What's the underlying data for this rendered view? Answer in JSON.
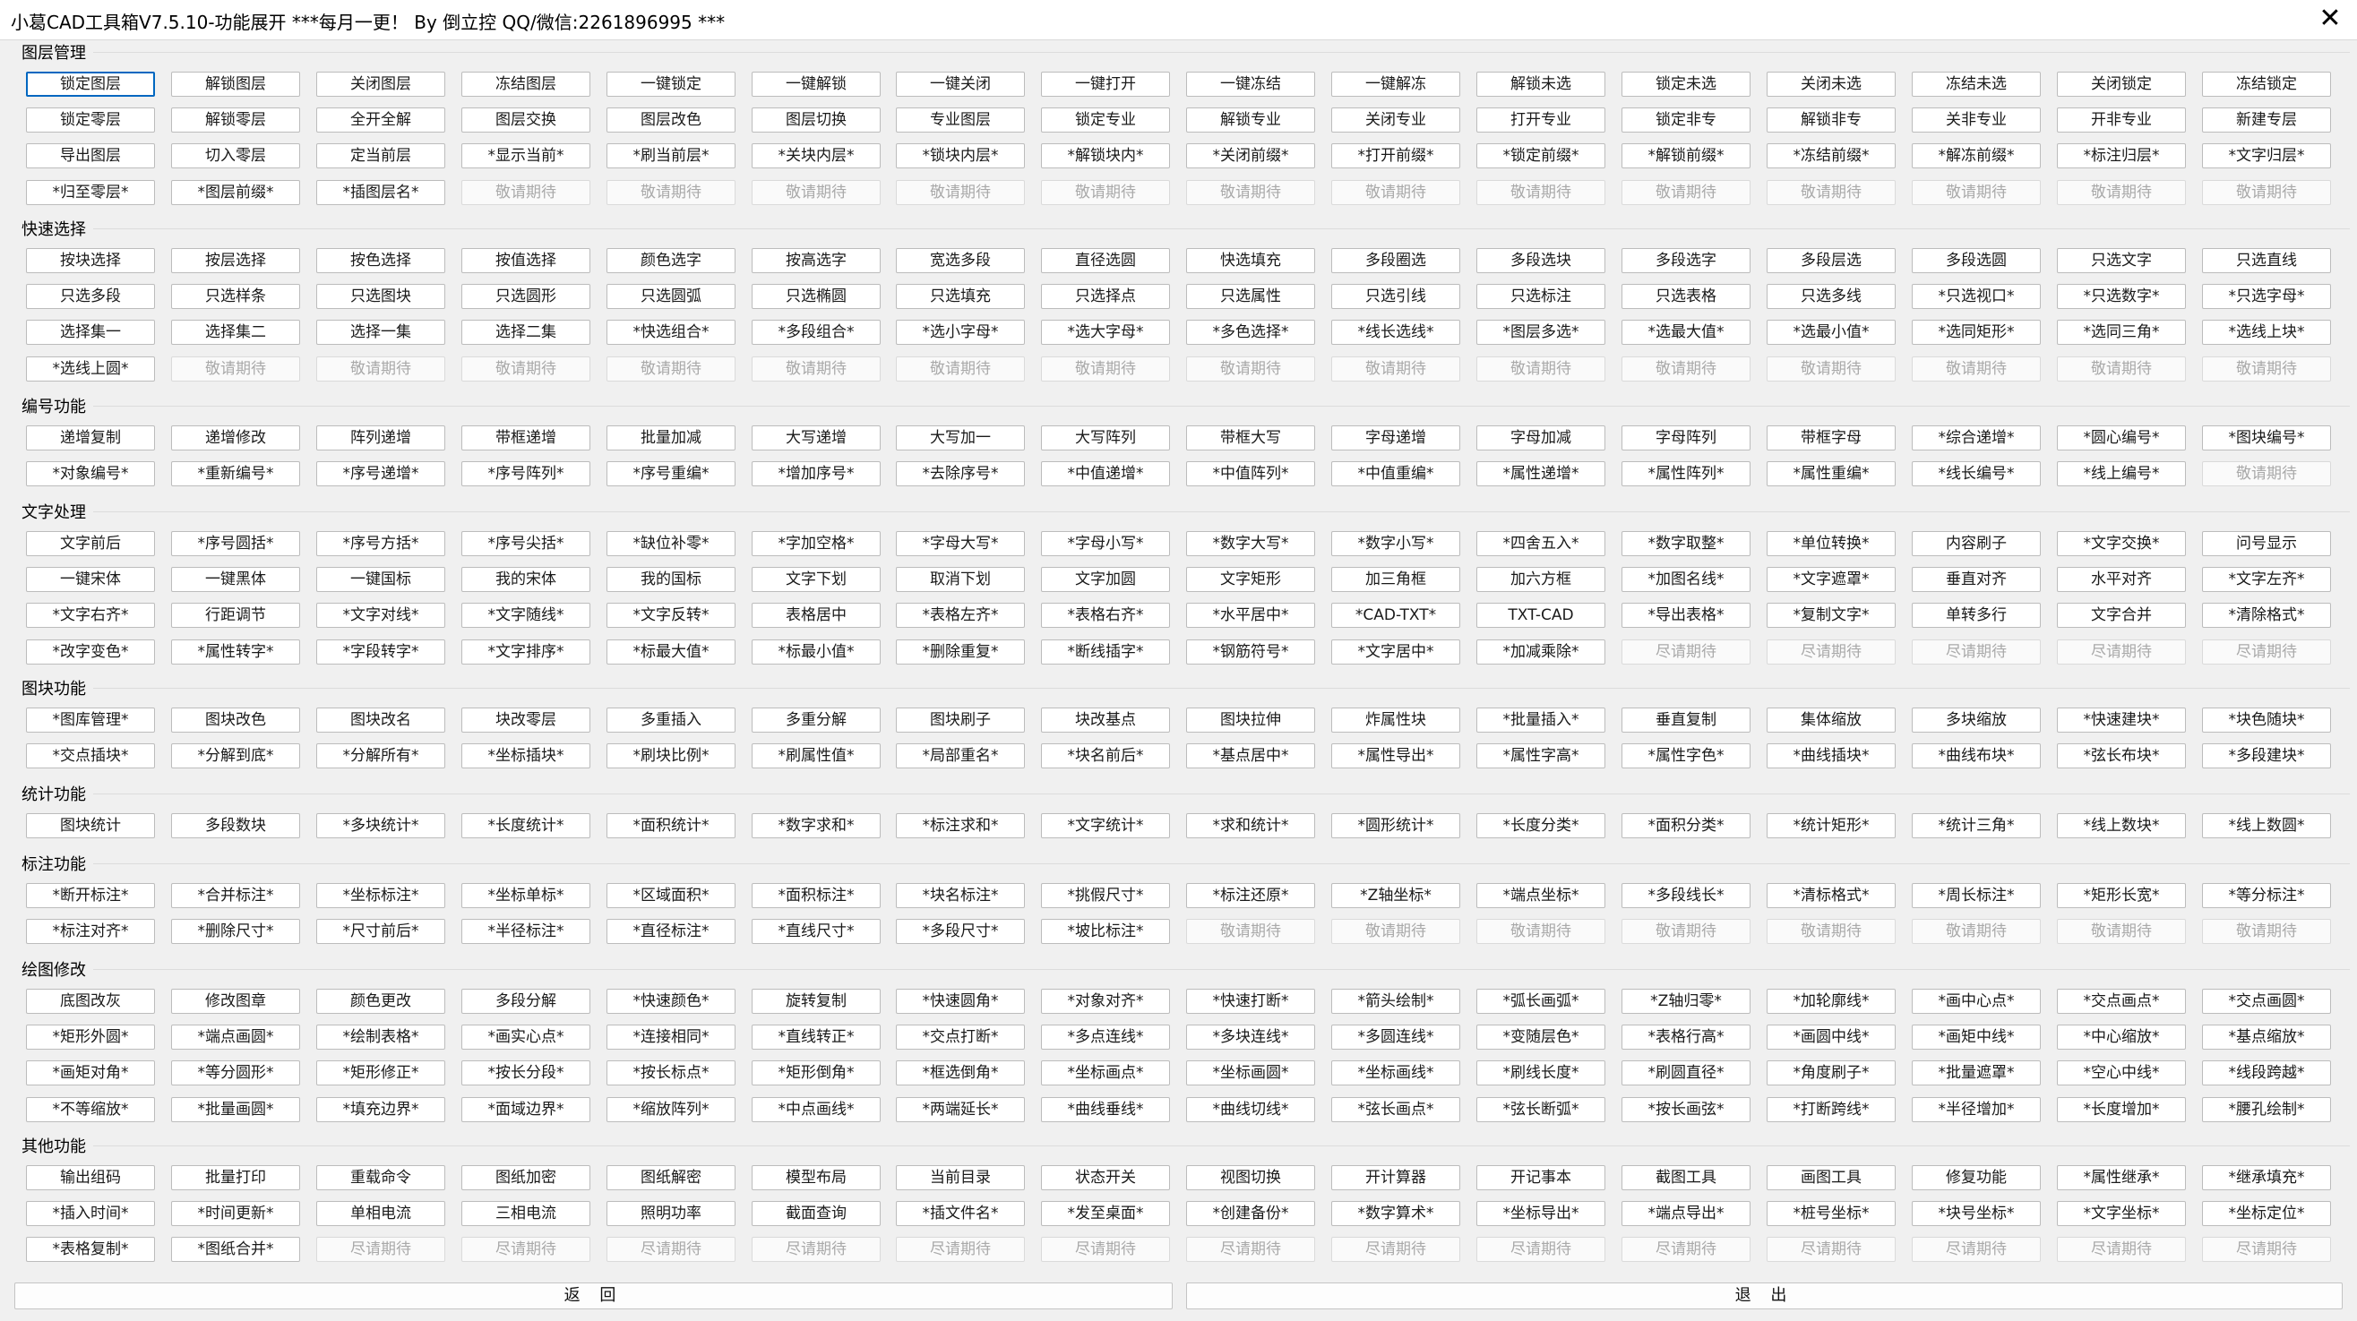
{
  "window": {
    "title": "小葛CAD工具箱V7.5.10-功能展开  ***每月一更！ By 倒立控 QQ/微信:2261896995 ***",
    "close_glyph": "✕"
  },
  "groups": [
    {
      "label": "图层管理",
      "rows": [
        [
          "锁定图层",
          "解锁图层",
          "关闭图层",
          "冻结图层",
          "一键锁定",
          "一键解锁",
          "一键关闭",
          "一键打开",
          "一键冻结",
          "一键解冻",
          "解锁未选",
          "锁定未选",
          "关闭未选",
          "冻结未选",
          "关闭锁定",
          "冻结锁定"
        ],
        [
          "锁定零层",
          "解锁零层",
          "全开全解",
          "图层交换",
          "图层改色",
          "图层切换",
          "专业图层",
          "锁定专业",
          "解锁专业",
          "关闭专业",
          "打开专业",
          "锁定非专",
          "解锁非专",
          "关非专业",
          "开非专业",
          "新建专层"
        ],
        [
          "导出图层",
          "切入零层",
          "定当前层",
          "*显示当前*",
          "*刷当前层*",
          "*关块内层*",
          "*锁块内层*",
          "*解锁块内*",
          "*关闭前缀*",
          "*打开前缀*",
          "*锁定前缀*",
          "*解锁前缀*",
          "*冻结前缀*",
          "*解冻前缀*",
          "*标注归层*",
          "*文字归层*"
        ],
        [
          "*归至零层*",
          "*图层前缀*",
          "*插图层名*",
          "敬请期待",
          "敬请期待",
          "敬请期待",
          "敬请期待",
          "敬请期待",
          "敬请期待",
          "敬请期待",
          "敬请期待",
          "敬请期待",
          "敬请期待",
          "敬请期待",
          "敬请期待",
          "敬请期待"
        ]
      ]
    },
    {
      "label": "快速选择",
      "rows": [
        [
          "按块选择",
          "按层选择",
          "按色选择",
          "按值选择",
          "颜色选字",
          "按高选字",
          "宽选多段",
          "直径选圆",
          "快选填充",
          "多段圈选",
          "多段选块",
          "多段选字",
          "多段层选",
          "多段选圆",
          "只选文字",
          "只选直线"
        ],
        [
          "只选多段",
          "只选样条",
          "只选图块",
          "只选圆形",
          "只选圆弧",
          "只选椭圆",
          "只选填充",
          "只选择点",
          "只选属性",
          "只选引线",
          "只选标注",
          "只选表格",
          "只选多线",
          "*只选视口*",
          "*只选数字*",
          "*只选字母*"
        ],
        [
          "选择集一",
          "选择集二",
          "选择一集",
          "选择二集",
          "*快选组合*",
          "*多段组合*",
          "*选小字母*",
          "*选大字母*",
          "*多色选择*",
          "*线长选线*",
          "*图层多选*",
          "*选最大值*",
          "*选最小值*",
          "*选同矩形*",
          "*选同三角*",
          "*选线上块*"
        ],
        [
          "*选线上圆*",
          "敬请期待",
          "敬请期待",
          "敬请期待",
          "敬请期待",
          "敬请期待",
          "敬请期待",
          "敬请期待",
          "敬请期待",
          "敬请期待",
          "敬请期待",
          "敬请期待",
          "敬请期待",
          "敬请期待",
          "敬请期待",
          "敬请期待"
        ]
      ]
    },
    {
      "label": "编号功能",
      "rows": [
        [
          "递增复制",
          "递增修改",
          "阵列递增",
          "带框递增",
          "批量加减",
          "大写递增",
          "大写加一",
          "大写阵列",
          "带框大写",
          "字母递增",
          "字母加减",
          "字母阵列",
          "带框字母",
          "*综合递增*",
          "*圆心编号*",
          "*图块编号*"
        ],
        [
          "*对象编号*",
          "*重新编号*",
          "*序号递增*",
          "*序号阵列*",
          "*序号重编*",
          "*增加序号*",
          "*去除序号*",
          "*中值递增*",
          "*中值阵列*",
          "*中值重编*",
          "*属性递增*",
          "*属性阵列*",
          "*属性重编*",
          "*线长编号*",
          "*线上编号*",
          "敬请期待"
        ]
      ]
    },
    {
      "label": "文字处理",
      "rows": [
        [
          "文字前后",
          "*序号圆括*",
          "*序号方括*",
          "*序号尖括*",
          "*缺位补零*",
          "*字加空格*",
          "*字母大写*",
          "*字母小写*",
          "*数字大写*",
          "*数字小写*",
          "*四舍五入*",
          "*数字取整*",
          "*单位转换*",
          "内容刷子",
          "*文字交换*",
          "问号显示"
        ],
        [
          "一键宋体",
          "一键黑体",
          "一键国标",
          "我的宋体",
          "我的国标",
          "文字下划",
          "取消下划",
          "文字加圆",
          "文字矩形",
          "加三角框",
          "加六方框",
          "*加图名线*",
          "*文字遮罩*",
          "垂直对齐",
          "水平对齐",
          "*文字左齐*"
        ],
        [
          "*文字右齐*",
          "行距调节",
          "*文字对线*",
          "*文字随线*",
          "*文字反转*",
          "表格居中",
          "*表格左齐*",
          "*表格右齐*",
          "*水平居中*",
          "*CAD-TXT*",
          "TXT-CAD",
          "*导出表格*",
          "*复制文字*",
          "单转多行",
          "文字合并",
          "*清除格式*"
        ],
        [
          "*改字变色*",
          "*属性转字*",
          "*字段转字*",
          "*文字排序*",
          "*标最大值*",
          "*标最小值*",
          "*删除重复*",
          "*断线插字*",
          "*钢筋符号*",
          "*文字居中*",
          "*加减乘除*",
          "尽请期待",
          "尽请期待",
          "尽请期待",
          "尽请期待",
          "尽请期待"
        ]
      ]
    },
    {
      "label": "图块功能",
      "rows": [
        [
          "*图库管理*",
          "图块改色",
          "图块改名",
          "块改零层",
          "多重插入",
          "多重分解",
          "图块刷子",
          "块改基点",
          "图块拉伸",
          "炸属性块",
          "*批量插入*",
          "垂直复制",
          "集体缩放",
          "多块缩放",
          "*快速建块*",
          "*块色随块*"
        ],
        [
          "*交点插块*",
          "*分解到底*",
          "*分解所有*",
          "*坐标插块*",
          "*刷块比例*",
          "*刷属性值*",
          "*局部重名*",
          "*块名前后*",
          "*基点居中*",
          "*属性导出*",
          "*属性字高*",
          "*属性字色*",
          "*曲线插块*",
          "*曲线布块*",
          "*弦长布块*",
          "*多段建块*"
        ]
      ]
    },
    {
      "label": "统计功能",
      "rows": [
        [
          "图块统计",
          "多段数块",
          "*多块统计*",
          "*长度统计*",
          "*面积统计*",
          "*数字求和*",
          "*标注求和*",
          "*文字统计*",
          "*求和统计*",
          "*圆形统计*",
          "*长度分类*",
          "*面积分类*",
          "*统计矩形*",
          "*统计三角*",
          "*线上数块*",
          "*线上数圆*"
        ]
      ]
    },
    {
      "label": "标注功能",
      "rows": [
        [
          "*断开标注*",
          "*合并标注*",
          "*坐标标注*",
          "*坐标单标*",
          "*区域面积*",
          "*面积标注*",
          "*块名标注*",
          "*挑假尺寸*",
          "*标注还原*",
          "*Z轴坐标*",
          "*端点坐标*",
          "*多段线长*",
          "*清标格式*",
          "*周长标注*",
          "*矩形长宽*",
          "*等分标注*"
        ],
        [
          "*标注对齐*",
          "*删除尺寸*",
          "*尺寸前后*",
          "*半径标注*",
          "*直径标注*",
          "*直线尺寸*",
          "*多段尺寸*",
          "*坡比标注*",
          "敬请期待",
          "敬请期待",
          "敬请期待",
          "敬请期待",
          "敬请期待",
          "敬请期待",
          "敬请期待",
          "敬请期待"
        ]
      ]
    },
    {
      "label": "绘图修改",
      "rows": [
        [
          "底图改灰",
          "修改图章",
          "颜色更改",
          "多段分解",
          "*快速颜色*",
          "旋转复制",
          "*快速圆角*",
          "*对象对齐*",
          "*快速打断*",
          "*箭头绘制*",
          "*弧长画弧*",
          "*Z轴归零*",
          "*加轮廓线*",
          "*画中心点*",
          "*交点画点*",
          "*交点画圆*"
        ],
        [
          "*矩形外圆*",
          "*端点画圆*",
          "*绘制表格*",
          "*画实心点*",
          "*连接相同*",
          "*直线转正*",
          "*交点打断*",
          "*多点连线*",
          "*多块连线*",
          "*多圆连线*",
          "*变随层色*",
          "*表格行高*",
          "*画圆中线*",
          "*画矩中线*",
          "*中心缩放*",
          "*基点缩放*"
        ],
        [
          "*画矩对角*",
          "*等分圆形*",
          "*矩形修正*",
          "*按长分段*",
          "*按长标点*",
          "*矩形倒角*",
          "*框选倒角*",
          "*坐标画点*",
          "*坐标画圆*",
          "*坐标画线*",
          "*刷线长度*",
          "*刷圆直径*",
          "*角度刷子*",
          "*批量遮罩*",
          "*空心中线*",
          "*线段跨越*"
        ],
        [
          "*不等缩放*",
          "*批量画圆*",
          "*填充边界*",
          "*面域边界*",
          "*缩放阵列*",
          "*中点画线*",
          "*两端延长*",
          "*曲线垂线*",
          "*曲线切线*",
          "*弦长画点*",
          "*弦长断弧*",
          "*按长画弦*",
          "*打断跨线*",
          "*半径增加*",
          "*长度增加*",
          "*腰孔绘制*"
        ]
      ]
    },
    {
      "label": "其他功能",
      "rows": [
        [
          "输出组码",
          "批量打印",
          "重载命令",
          "图纸加密",
          "图纸解密",
          "模型布局",
          "当前目录",
          "状态开关",
          "视图切换",
          "开计算器",
          "开记事本",
          "截图工具",
          "画图工具",
          "修复功能",
          "*属性继承*",
          "*继承填充*"
        ],
        [
          "*插入时间*",
          "*时间更新*",
          "单相电流",
          "三相电流",
          "照明功率",
          "截面查询",
          "*插文件名*",
          "*发至桌面*",
          "*创建备份*",
          "*数字算术*",
          "*坐标导出*",
          "*端点导出*",
          "*桩号坐标*",
          "*块号坐标*",
          "*文字坐标*",
          "*坐标定位*"
        ],
        [
          "*表格复制*",
          "*图纸合并*",
          "尽请期待",
          "尽请期待",
          "尽请期待",
          "尽请期待",
          "尽请期待",
          "尽请期待",
          "尽请期待",
          "尽请期待",
          "尽请期待",
          "尽请期待",
          "尽请期待",
          "尽请期待",
          "尽请期待",
          "尽请期待"
        ]
      ]
    }
  ],
  "footer": {
    "back_label": "返 回",
    "exit_label": "退 出"
  },
  "colors": {
    "focus_border": "#0067c0",
    "placeholder_text": "#a9a9a9"
  }
}
